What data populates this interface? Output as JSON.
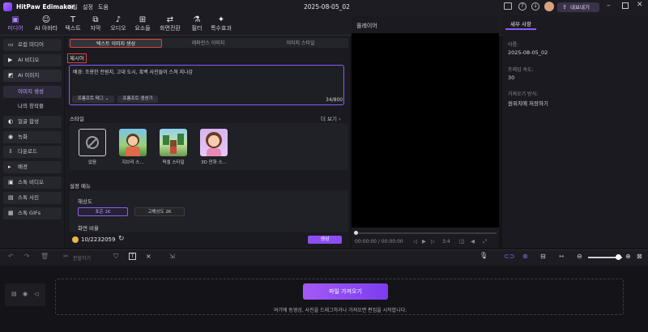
{
  "app": {
    "name": "HitPaw Edimakor",
    "menu": [
      "파일",
      "설정",
      "도움"
    ],
    "project_title": "2025-08-05_02",
    "export_label": "내보내기"
  },
  "toolbar": {
    "items": [
      {
        "label": "미디어",
        "icon": "media-icon"
      },
      {
        "label": "AI 아바타",
        "icon": "avatar-icon"
      },
      {
        "label": "텍스트",
        "icon": "text-icon"
      },
      {
        "label": "자막",
        "icon": "subtitle-icon"
      },
      {
        "label": "오디오",
        "icon": "audio-icon"
      },
      {
        "label": "요소들",
        "icon": "elements-icon"
      },
      {
        "label": "화면전환",
        "icon": "transition-icon"
      },
      {
        "label": "필터",
        "icon": "filter-icon"
      },
      {
        "label": "특수효과",
        "icon": "effects-icon"
      }
    ]
  },
  "sidebar": {
    "items": [
      {
        "label": "로컬 미디어"
      },
      {
        "label": "AI 비디오"
      },
      {
        "label": "AI 이미지"
      },
      {
        "label": "이미지 생성"
      },
      {
        "label": "나의 창작물"
      },
      {
        "label": "얼굴 합성"
      },
      {
        "label": "녹화"
      },
      {
        "label": "다운로드"
      },
      {
        "label": "배경"
      },
      {
        "label": "스톡 비디오"
      },
      {
        "label": "스톡 사진"
      },
      {
        "label": "스톡 GIFs"
      }
    ]
  },
  "panel": {
    "tabs": [
      "텍스트 이미지 생성",
      "레퍼런스 이미지",
      "이미지 스타일"
    ],
    "prompt_label": "제시어",
    "prompt_text": "배경: 조용한 전원지, 고대 도시, 흑백 사진들이 스쳐 지나감",
    "prompt_tag_btn": "프롬프트 태그",
    "prompt_gen_btn": "프롬프트 생성기",
    "char_count": "34/800",
    "style_label": "스타일",
    "more_label": "더 보기",
    "styles": [
      {
        "label": "없음"
      },
      {
        "label": "지브리 스..."
      },
      {
        "label": "픽셀 스타일"
      },
      {
        "label": "3D 만화 스..."
      }
    ],
    "settings_label": "설정 메뉴",
    "resolution_label": "해상도",
    "res_options": [
      "표준 1K",
      "고해상도 2K"
    ],
    "aspect_label": "화면 비율",
    "credits": "10/2232059",
    "generate_btn": "생성"
  },
  "player": {
    "title": "플레이어",
    "time": "00:00:00 / 00:00:00",
    "speed": "3:4"
  },
  "details": {
    "tab": "세부 사항",
    "fields": [
      {
        "label": "이름:",
        "value": "2025-08-05_02"
      },
      {
        "label": "프레임 속도:",
        "value": "30"
      },
      {
        "label": "가져오기 방식:",
        "value": "원위치에 저장하기"
      }
    ]
  },
  "timeline": {
    "split_label": "분할하기",
    "import_btn": "파일 가져오기",
    "hint": "여기에 동영상, 사진을 드래그하거나 가져오면 편집을 시작합니다."
  },
  "colors": {
    "accent": "#9b5cf6",
    "highlight": "#e0453a",
    "bg": "#141418"
  }
}
